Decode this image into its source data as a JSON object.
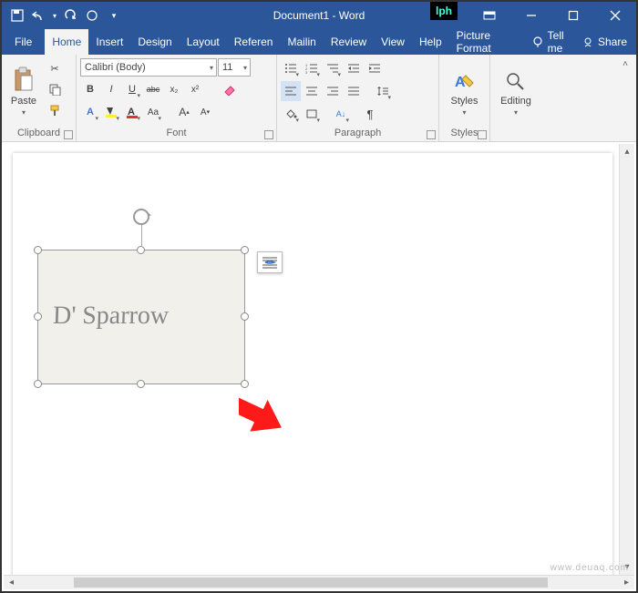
{
  "window": {
    "title": "Document1 - Word",
    "qat": {
      "save": "save-icon",
      "undo": "undo-icon",
      "redo": "redo-icon",
      "touch": "touch-mode-icon",
      "customize": "customize-qat-icon"
    }
  },
  "tabs": {
    "file": "File",
    "home": "Home",
    "insert": "Insert",
    "design": "Design",
    "layout": "Layout",
    "references": "Referen",
    "mailings": "Mailin",
    "review": "Review",
    "view": "View",
    "help": "Help",
    "picture_format": "Picture Format",
    "tell_me": "Tell me",
    "share": "Share"
  },
  "ribbon": {
    "clipboard": {
      "label": "Clipboard",
      "paste": "Paste"
    },
    "font": {
      "label": "Font",
      "name": "Calibri (Body)",
      "size": "11",
      "buttons": {
        "bold": "B",
        "italic": "I",
        "underline": "U",
        "strike": "abc",
        "sub": "x₂",
        "sup": "x²"
      }
    },
    "paragraph": {
      "label": "Paragraph"
    },
    "styles": {
      "label": "Styles",
      "button": "Styles"
    },
    "editing": {
      "label": "",
      "button": "Editing"
    }
  },
  "document": {
    "signature_text": "D' Sparrow"
  },
  "watermark": "www.deuaq.com"
}
